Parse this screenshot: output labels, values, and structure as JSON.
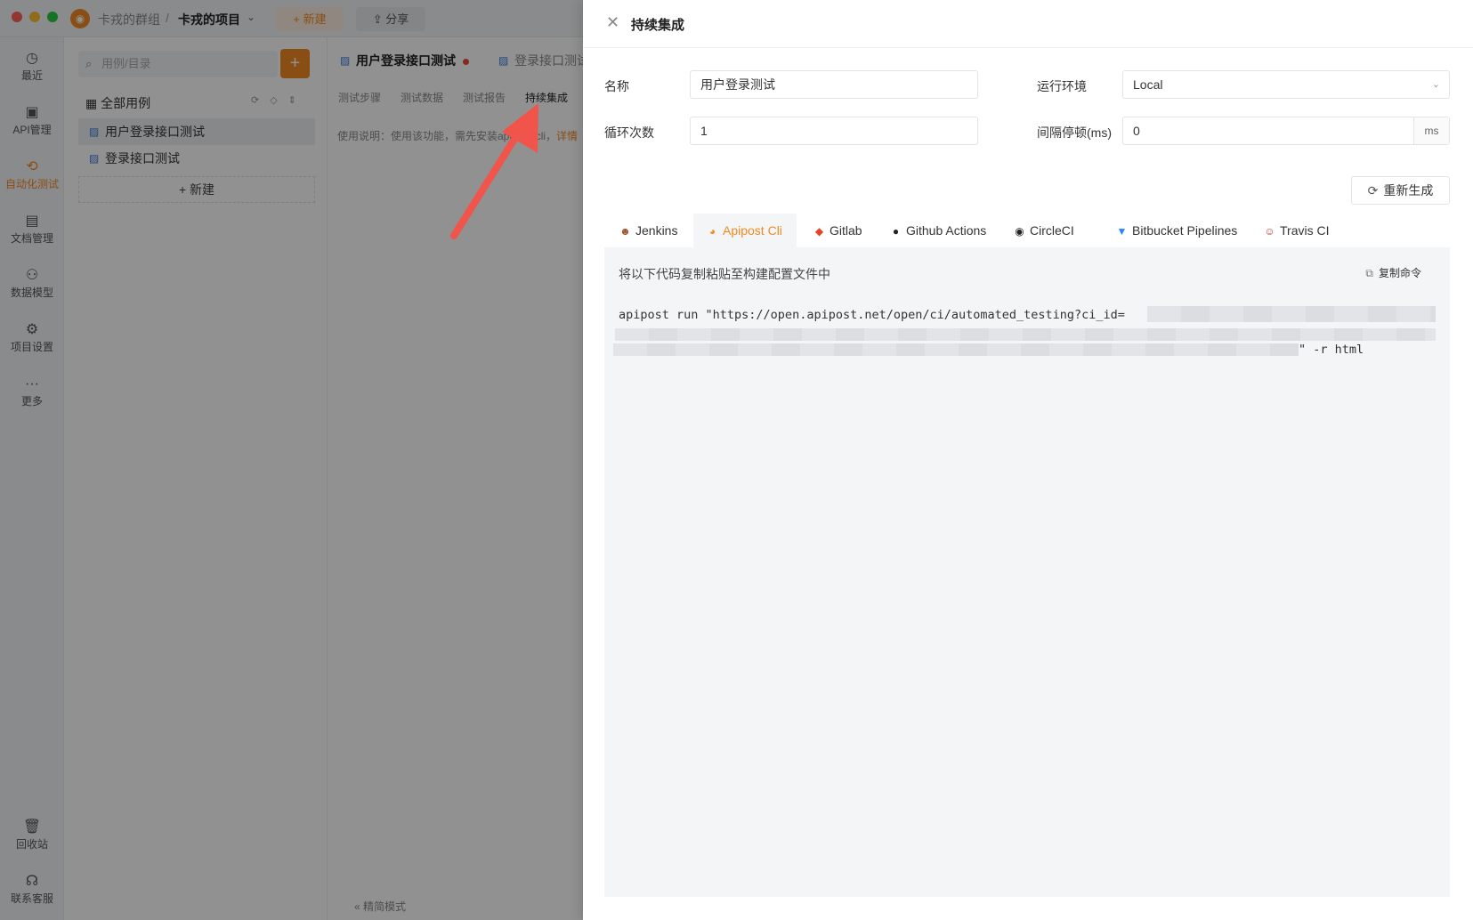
{
  "app": {
    "team": "卡戎的群组",
    "separator": "/",
    "project": "卡戎的项目",
    "new_label": "+ 新建",
    "share_label": "分享"
  },
  "nav": {
    "recent": "最近",
    "api": "API管理",
    "autotest": "自动化测试",
    "docs": "文档管理",
    "models": "数据模型",
    "settings": "项目设置",
    "more": "更多",
    "trash": "回收站",
    "support": "联系客服"
  },
  "tree": {
    "search_placeholder": "用例/目录",
    "root": "全部用例",
    "items": [
      "用户登录接口测试",
      "登录接口测试"
    ],
    "new_label": "+ 新建"
  },
  "main": {
    "tabs": [
      "用户登录接口测试",
      "登录接口测试"
    ],
    "sub_tabs": [
      "测试步骤",
      "测试数据",
      "测试报告",
      "持续集成"
    ],
    "usage_text": "使用说明：使用该功能，需先安装apipost-cli，",
    "usage_link": "详情",
    "compact_mode": "精简模式"
  },
  "drawer": {
    "title": "持续集成",
    "name_label": "名称",
    "name_value": "用户登录测试",
    "env_label": "运行环境",
    "env_value": "Local",
    "loop_label": "循环次数",
    "loop_value": "1",
    "interval_label": "间隔停顿(ms)",
    "interval_value": "0",
    "interval_unit": "ms",
    "regen_label": "重新生成",
    "ci_tabs": [
      "Jenkins",
      "Apipost Cli",
      "Gitlab",
      "Github Actions",
      "CircleCI",
      "Bitbucket Pipelines",
      "Travis CI"
    ],
    "active_ci_tab": "Apipost Cli",
    "hint": "将以下代码复制粘贴至构建配置文件中",
    "copy_label": "复制命令",
    "code_prefix": "apipost run \"https://open.apipost.net/open/ci/automated_testing?ci_id=",
    "code_suffix": "\" -r html"
  },
  "colors": {
    "accent": "#f08a24",
    "link_blue": "#3a7bd5",
    "overlay": "rgba(0,0,0,0.43)",
    "arrow": "#f0544a"
  }
}
